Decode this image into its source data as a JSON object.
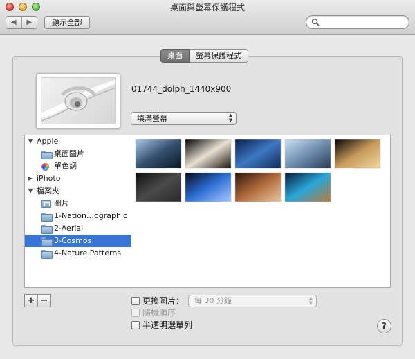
{
  "window": {
    "title": "桌面與螢幕保護程式"
  },
  "toolbar": {
    "back_icon": "back-arrow-icon",
    "forward_icon": "forward-arrow-icon",
    "show_all_label": "顯示全部",
    "search_placeholder": ""
  },
  "tabs": [
    {
      "label": "桌面",
      "selected": true
    },
    {
      "label": "螢幕保護程式",
      "selected": false
    }
  ],
  "desktop": {
    "filename": "01744_dolph_1440x900",
    "fit_option": "填滿螢幕"
  },
  "sources": [
    {
      "label": "Apple",
      "type": "group",
      "expanded": true
    },
    {
      "label": "桌面圖片",
      "type": "folder",
      "icon": "folder-icon"
    },
    {
      "label": "單色調",
      "type": "colors",
      "icon": "color-wheel-icon"
    },
    {
      "label": "iPhoto",
      "type": "group",
      "expanded": false
    },
    {
      "label": "檔案夾",
      "type": "group",
      "expanded": true
    },
    {
      "label": "圖片",
      "type": "photos",
      "icon": "pictures-folder-icon"
    },
    {
      "label": "1-Nation…ographic",
      "type": "folder",
      "icon": "folder-icon"
    },
    {
      "label": "2-Aerial",
      "type": "folder",
      "icon": "folder-icon"
    },
    {
      "label": "3-Cosmos",
      "type": "folder",
      "icon": "folder-icon",
      "selected": true
    },
    {
      "label": "4-Nature Patterns",
      "type": "folder",
      "icon": "folder-icon"
    }
  ],
  "thumbnails": [
    {
      "colors": [
        "#a9c6e8",
        "#34506e",
        "#0c1826"
      ]
    },
    {
      "colors": [
        "#050505",
        "#e8e0d2",
        "#1a1410"
      ]
    },
    {
      "colors": [
        "#0b1f4d",
        "#3d78c2",
        "#112a55"
      ]
    },
    {
      "colors": [
        "#c9dff0",
        "#6f8fb0",
        "#283b55"
      ]
    },
    {
      "colors": [
        "#050505",
        "#c89a5a",
        "#f0d7a2"
      ]
    },
    {
      "colors": [
        "#0d0d0d",
        "#4a4a4a",
        "#2a2a2a"
      ]
    },
    {
      "colors": [
        "#030a1a",
        "#2e6fd6",
        "#a8c8ff"
      ]
    },
    {
      "colors": [
        "#2a140c",
        "#b06a3a",
        "#e7c7a0"
      ]
    },
    {
      "colors": [
        "#041a33",
        "#2aa6d9",
        "#b87a3a"
      ]
    }
  ],
  "bottom": {
    "plus_label": "+",
    "minus_label": "−",
    "change_picture_label": "更換圖片：",
    "change_picture_checked": false,
    "interval_value": "每 30 分鐘",
    "random_order_label": "隨機順序",
    "random_order_enabled": false,
    "translucent_menu_label": "半透明選單列",
    "translucent_menu_checked": false,
    "help_label": "?"
  }
}
